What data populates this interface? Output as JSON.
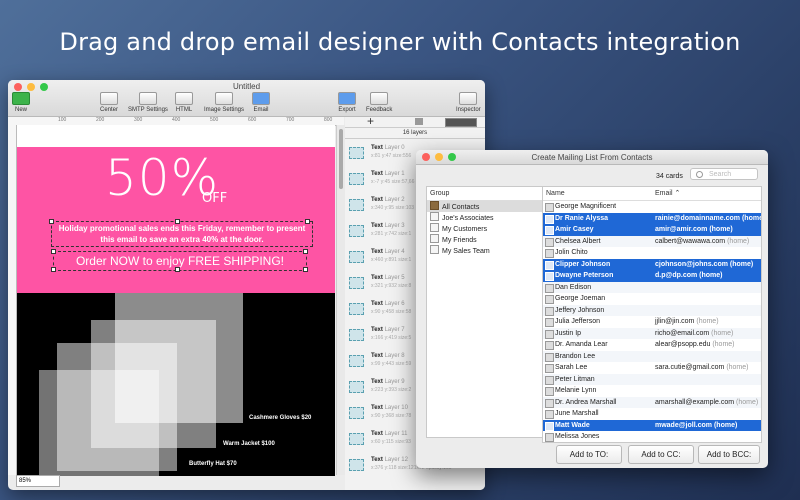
{
  "headline": "Drag and drop email designer with Contacts integration",
  "main_window": {
    "title": "Untitled",
    "toolbar": [
      {
        "label": "New",
        "icon": "plus-icon"
      },
      {
        "label": "Center",
        "icon": "center-icon"
      },
      {
        "label": "SMTP Settings",
        "icon": "smtp-icon"
      },
      {
        "label": "HTML",
        "icon": "html-icon"
      },
      {
        "label": "Image Settings",
        "icon": "image-icon"
      },
      {
        "label": "Email",
        "icon": "email-icon"
      },
      {
        "label": "Export",
        "icon": "export-icon"
      },
      {
        "label": "Feedback",
        "icon": "feedback-icon"
      },
      {
        "label": "Inspector",
        "icon": "inspector-icon"
      }
    ],
    "ruler_marks": [
      "100",
      "200",
      "300",
      "400",
      "500",
      "600",
      "700",
      "800"
    ],
    "zoom": "85%"
  },
  "design": {
    "big_percent": "50%",
    "off": "OFF",
    "promo_text": "Holiday promotional sales ends this Friday, remember to present this email to save an extra 40% at the door.",
    "order_text": "Order NOW to enjoy FREE SHIPPING!",
    "captions": [
      "Cashmere Gloves $20",
      "Warm Jacket $100",
      "Butterfly Hat $70"
    ],
    "pink_color": "#fe54a4"
  },
  "layers_panel": {
    "count": "16 layers",
    "items": [
      {
        "type": "Text",
        "layer": "Layer 0",
        "info": "x:81 y:47 size:556"
      },
      {
        "type": "Text",
        "layer": "Layer 1",
        "info": "x:-7 y:45 size:57,66"
      },
      {
        "type": "Text",
        "layer": "Layer 2",
        "info": "x:340 y:95 size:103"
      },
      {
        "type": "Text",
        "layer": "Layer 3",
        "info": "x:281 y:742 size:1"
      },
      {
        "type": "Text",
        "layer": "Layer 4",
        "info": "x:460 y:891 size:1"
      },
      {
        "type": "Text",
        "layer": "Layer 5",
        "info": "x:321 y:932 size:8"
      },
      {
        "type": "Text",
        "layer": "Layer 6",
        "info": "x:90 y:458 size:58"
      },
      {
        "type": "Text",
        "layer": "Layer 7",
        "info": "x:166 y:419 size:5"
      },
      {
        "type": "Text",
        "layer": "Layer 8",
        "info": "x:99 y:443 size:59"
      },
      {
        "type": "Text",
        "layer": "Layer 9",
        "info": "x:223 y:393 size:2"
      },
      {
        "type": "Text",
        "layer": "Layer 10",
        "info": "x:90 y:368 size:78"
      },
      {
        "type": "Text",
        "layer": "Layer 11",
        "info": "x:60 y:115 size:93"
      },
      {
        "type": "Text",
        "layer": "Layer 12",
        "info": "x:376 y:118 size:121x92 opacity:100"
      }
    ]
  },
  "dialog": {
    "title": "Create Mailing List From Contacts",
    "cards_count": "34 cards",
    "search_placeholder": "Search",
    "group_header": "Group",
    "groups": [
      "All Contacts",
      "Joe's Associates",
      "My Customers",
      "My Friends",
      "My Sales Team"
    ],
    "name_header": "Name",
    "email_header": "Email",
    "contacts": [
      {
        "name": "George Magnificent",
        "email": "",
        "tag": "",
        "selected": false
      },
      {
        "name": "Dr Ranie Alyssa",
        "email": "rainie@domainname.com",
        "tag": "(home)",
        "selected": true
      },
      {
        "name": "Amir Casey",
        "email": "amir@amir.com",
        "tag": "(home)",
        "selected": true
      },
      {
        "name": "Chelsea Albert",
        "email": "calbert@wawawa.com",
        "tag": "(home)",
        "selected": false
      },
      {
        "name": "Jolin Chito",
        "email": "",
        "tag": "",
        "selected": false
      },
      {
        "name": "Clipper Johnson",
        "email": "cjohnson@johns.com",
        "tag": "(home)",
        "selected": true
      },
      {
        "name": "Dwayne Peterson",
        "email": "d.p@dp.com",
        "tag": "(home)",
        "selected": true
      },
      {
        "name": "Dan Edison",
        "email": "",
        "tag": "",
        "selected": false
      },
      {
        "name": "George Joeman",
        "email": "",
        "tag": "",
        "selected": false
      },
      {
        "name": "Jeffery Johnson",
        "email": "",
        "tag": "",
        "selected": false
      },
      {
        "name": "Julia Jefferson",
        "email": "jjlin@jin.com",
        "tag": "(home)",
        "selected": false
      },
      {
        "name": "Justin Ip",
        "email": "richo@email.com",
        "tag": "(home)",
        "selected": false
      },
      {
        "name": "Dr. Amanda Lear",
        "email": "alear@psopp.edu",
        "tag": "(home)",
        "selected": false
      },
      {
        "name": "Brandon Lee",
        "email": "",
        "tag": "",
        "selected": false
      },
      {
        "name": "Sarah Lee",
        "email": "sara.cutie@gmail.com",
        "tag": "(home)",
        "selected": false
      },
      {
        "name": "Peter Litman",
        "email": "",
        "tag": "",
        "selected": false
      },
      {
        "name": "Melanie Lynn",
        "email": "",
        "tag": "",
        "selected": false
      },
      {
        "name": "Dr. Andrea Marshall",
        "email": "amarshall@example.com",
        "tag": "(home)",
        "selected": false
      },
      {
        "name": "June Marshall",
        "email": "",
        "tag": "",
        "selected": false
      },
      {
        "name": "Matt Wade",
        "email": "mwade@joll.com",
        "tag": "(home)",
        "selected": true
      },
      {
        "name": "Melissa Jones",
        "email": "",
        "tag": "",
        "selected": false
      }
    ],
    "buttons": {
      "to": "Add to TO:",
      "cc": "Add to CC:",
      "bcc": "Add to BCC:"
    },
    "selection_color": "#1f68d6"
  }
}
